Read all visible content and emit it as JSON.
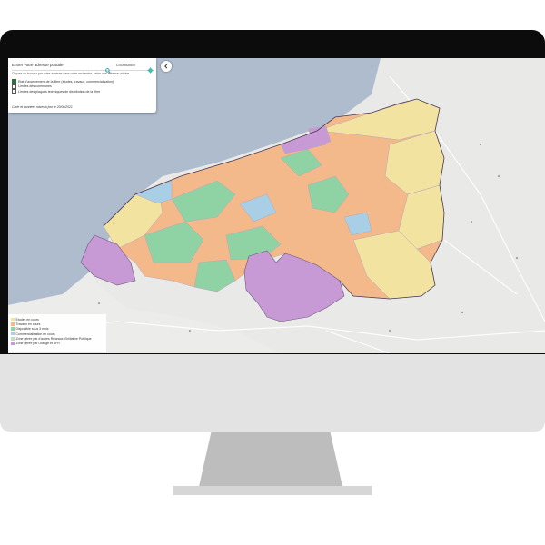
{
  "search": {
    "placeholder": "Entrer votre adresse postale",
    "geolocation_label": "Localisation",
    "hint": "Cliquez ou trouvez par votre adresse dans votre recherche, selon une adresse voisine.",
    "layers": [
      {
        "label": "Etat d'avancement de la fibre (études, travaux, commercialisation)",
        "checked": true
      },
      {
        "label": "Limites des communes",
        "checked": false
      },
      {
        "label": "Limites des plaques techniques de distribution de la fibre",
        "checked": false
      }
    ],
    "updated": "Carte et données mises à jour le 20/08/2021"
  },
  "legend": {
    "items": [
      {
        "label": "Etudes en cours",
        "color": "#f3e3a0"
      },
      {
        "label": "Travaux en cours",
        "color": "#f3b98a"
      },
      {
        "label": "Disponible sous 3 mois",
        "color": "#8fd3a4"
      },
      {
        "label": "Commercialisation en cours",
        "color": "#a8cfe6"
      },
      {
        "label": "Zone gérée par d'autres Réseaux d'Initiative Publique",
        "color": "#c9d9c0"
      },
      {
        "label": "Zone gérée par Orange et SFR",
        "color": "#c79ad6"
      }
    ]
  },
  "map": {
    "colors": {
      "sea": "#aebccd",
      "land": "#ececea",
      "border": "#6b5a7a"
    }
  }
}
